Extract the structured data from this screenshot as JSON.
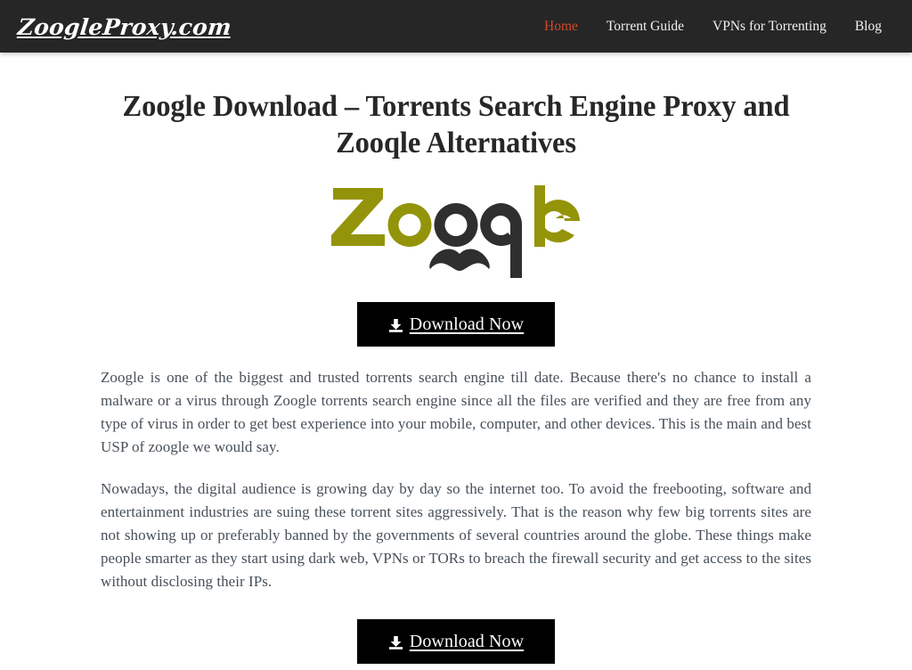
{
  "header": {
    "brand": "ZoogleProxy.com",
    "nav": [
      {
        "label": "Home",
        "active": true
      },
      {
        "label": "Torrent Guide",
        "active": false
      },
      {
        "label": "VPNs for Torrenting",
        "active": false
      },
      {
        "label": "Blog",
        "active": false
      }
    ],
    "background_color": "#262626",
    "active_link_color": "#d5472a",
    "link_color": "#f2f2f2"
  },
  "main": {
    "title": "Zoogle Download – Torrents Search Engine Proxy and Zooqle Alternatives",
    "logo": {
      "text": "Zoogle",
      "alt": "Zoogle logo with mustache",
      "olive_color": "#94940a",
      "dark_color": "#2f2f2f",
      "letters": [
        {
          "char": "Z",
          "color": "#94940a"
        },
        {
          "char": "o",
          "color": "#94940a"
        },
        {
          "char": "o",
          "color": "#2f2f2f"
        },
        {
          "char": "g",
          "color": "#2f2f2f"
        },
        {
          "char": "l",
          "color": "#94940a"
        },
        {
          "char": "e",
          "color": "#94940a"
        }
      ],
      "mustache": true
    },
    "download_button_top": {
      "label": "Download Now",
      "icon": "download-icon",
      "background_color": "#000000",
      "text_color": "#ffffff"
    },
    "download_button_bottom": {
      "label": "Download Now",
      "icon": "download-icon",
      "background_color": "#000000",
      "text_color": "#ffffff"
    },
    "paragraphs": [
      "Zoogle is one of the biggest and trusted torrents search engine till date. Because there's no chance to install a malware or a virus through Zoogle torrents search engine since all the files are verified and they are free from any type of virus in order to get best experience into your mobile, computer, and other devices. This is the main and best USP of zoogle we would say.",
      "Nowadays, the digital audience is growing day by day so the internet too. To avoid the freebooting, software and entertainment industries are suing these torrent sites aggressively. That is the reason why few big torrents sites are not showing up or preferably banned by the governments of several countries around the globe. These things make people smarter as they start using dark web, VPNs or TORs to breach the firewall security and get access to the sites without disclosing their IPs."
    ],
    "text_color": "#475059",
    "title_color": "#272727"
  }
}
